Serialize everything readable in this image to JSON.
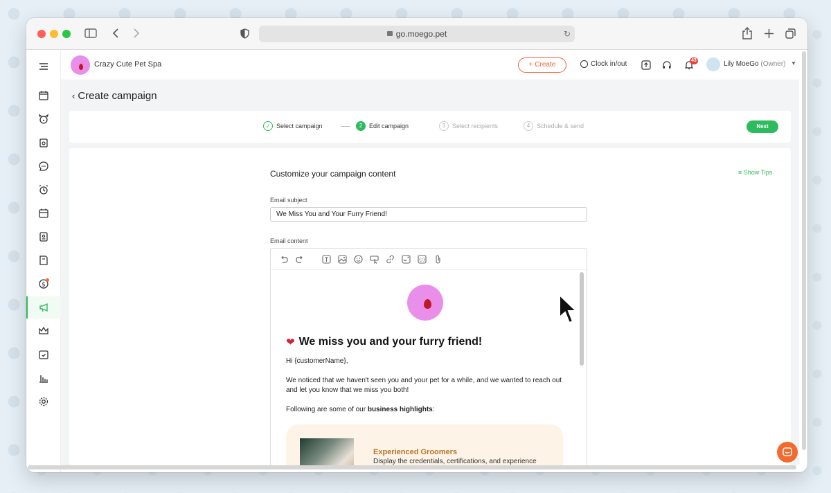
{
  "browser": {
    "url": "go.moego.pet"
  },
  "header": {
    "business_name": "Crazy Cute Pet Spa",
    "create_label": "+ Create",
    "clock_label": "Clock in/out",
    "notification_count": "43",
    "user_name": "Lily MoeGo",
    "user_role": "(Owner)"
  },
  "page": {
    "title": "Create campaign",
    "back_icon": "chevron-left-icon"
  },
  "stepper": {
    "steps": [
      {
        "number": "✓",
        "label": "Select campaign",
        "state": "done"
      },
      {
        "number": "2",
        "label": "Edit campaign",
        "state": "current"
      },
      {
        "number": "3",
        "label": "Select recipients",
        "state": "todo"
      },
      {
        "number": "4",
        "label": "Schedule & send",
        "state": "todo"
      }
    ],
    "next_label": "Next"
  },
  "form": {
    "title": "Customize your campaign content",
    "show_tips": "Show Tips",
    "subject_label": "Email subject",
    "subject_value": "We Miss You and Your Furry Friend!",
    "content_label": "Email content"
  },
  "email": {
    "heading": "We miss you and your furry friend!",
    "greeting": "Hi {customerName},",
    "para1": "We noticed that we haven't seen you and your pet for a while, and we wanted to reach out and let you know that we miss you both!",
    "para2_prefix": "Following are some of our ",
    "para2_bold": "business highlights",
    "para2_suffix": ":",
    "highlight_title": "Experienced Groomers",
    "highlight_desc": "Display the credentials, certifications, and experience"
  },
  "colors": {
    "accent_green": "#2dbb5d",
    "accent_orange": "#f0603a",
    "highlight_bg": "#fdf3e6"
  }
}
